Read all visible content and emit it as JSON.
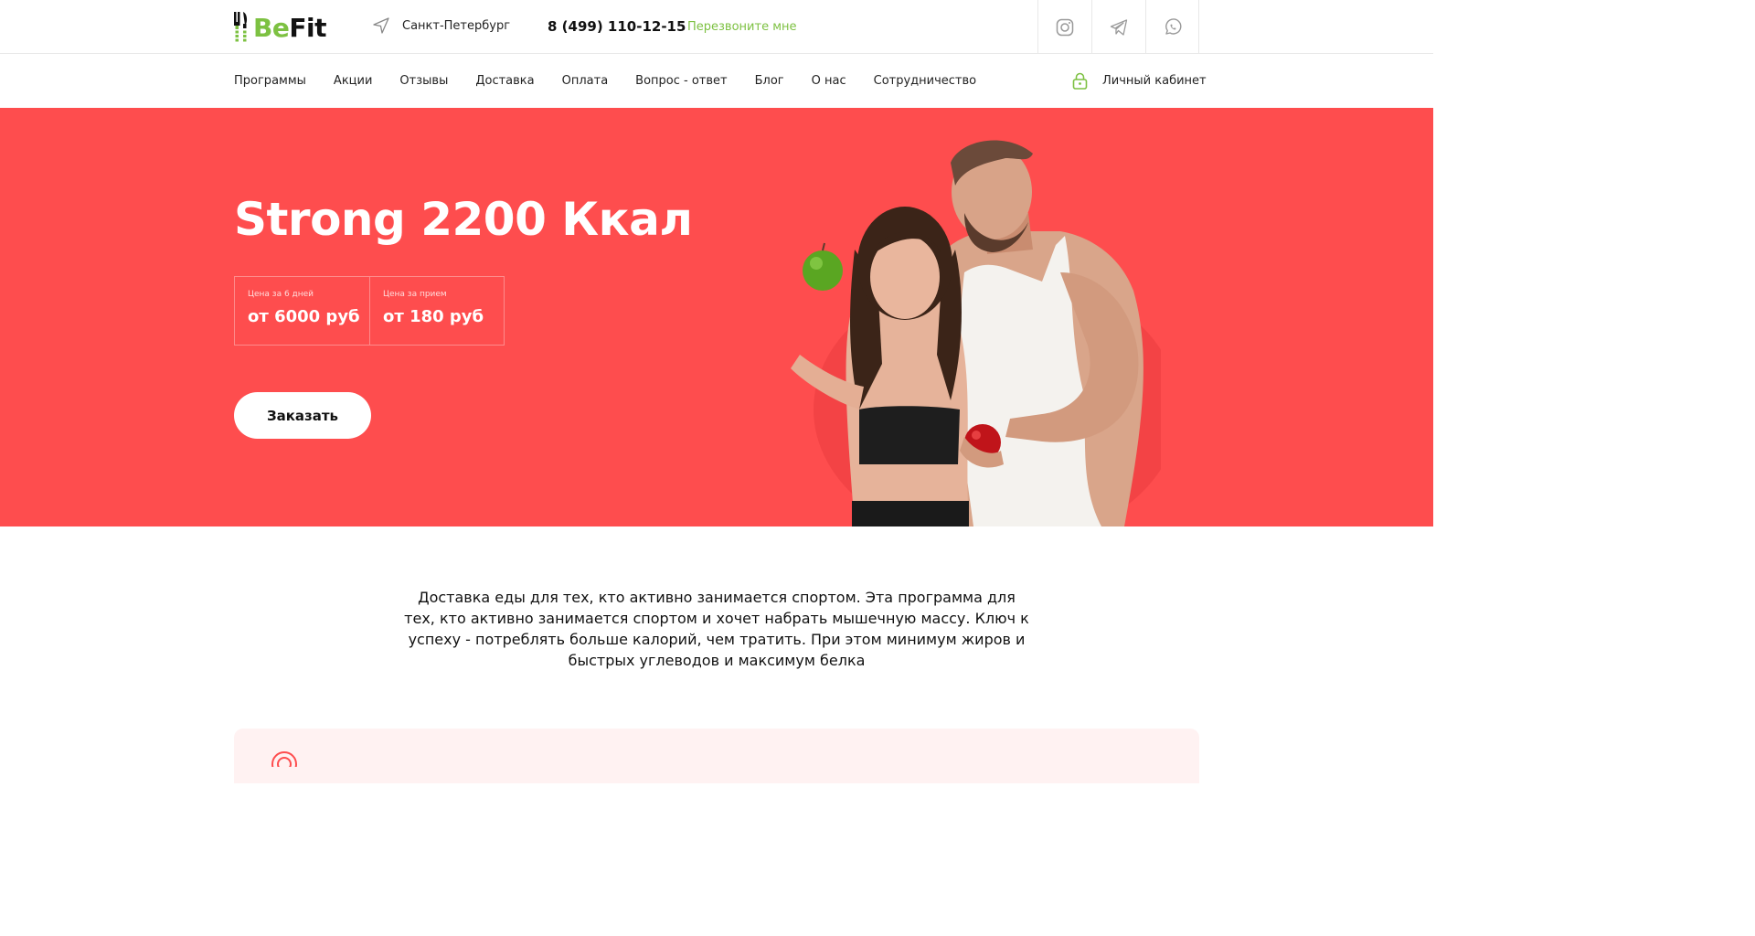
{
  "header": {
    "logo": {
      "part1": "Be",
      "part2": "Fit"
    },
    "city": "Санкт-Петербург",
    "phone": "8 (499) 110-12-15",
    "callback_label": "Перезвоните мне",
    "socials": [
      "instagram-icon",
      "telegram-icon",
      "whatsapp-icon"
    ]
  },
  "nav": {
    "items": [
      "Программы",
      "Акции",
      "Отзывы",
      "Доставка",
      "Оплата",
      "Вопрос - ответ",
      "Блог",
      "О нас",
      "Сотрудничество"
    ],
    "cabinet_label": "Личный кабинет"
  },
  "hero": {
    "title": "Strong 2200 Ккал",
    "prices": [
      {
        "label": "Цена за 6 дней",
        "value": "от 6000 руб"
      },
      {
        "label": "Цена за прием",
        "value": "от 180 руб"
      }
    ],
    "order_label": "Заказать"
  },
  "description": "Доставка еды для тех, кто активно занимается спортом. Эта программа для тех, кто активно занимается спортом и хочет набрать мышечную массу. Ключ к успеху - потреблять больше калорий, чем тратить. При этом минимум жиров и быстрых углеводов и максимум белка",
  "colors": {
    "accent_green": "#7dc142",
    "hero_red": "#fe4d4e",
    "card_bg": "#fff2f2"
  }
}
